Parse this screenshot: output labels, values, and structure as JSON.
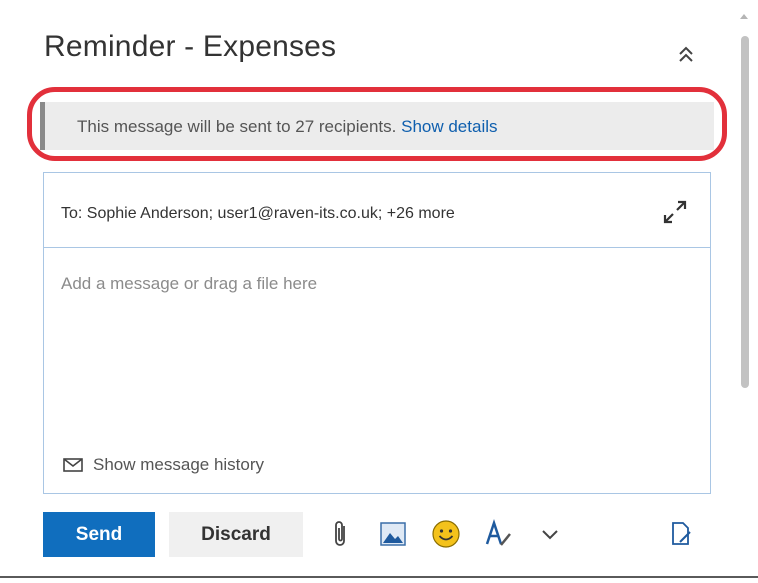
{
  "compose": {
    "subject_title": "Reminder - Expenses",
    "notice": {
      "text": "This message will be sent to 27 recipients.",
      "link": "Show details"
    },
    "to_line": "To:  Sophie Anderson;  user1@raven-its.co.uk;  +26 more",
    "body_placeholder": "Add a message or drag a file here",
    "history_label": "Show message history"
  },
  "toolbar": {
    "send_label": "Send",
    "discard_label": "Discard",
    "tools": [
      "attach-icon",
      "image-icon",
      "emoji-icon",
      "format-text-icon",
      "more-options-chevron-icon",
      "open-in-new-window-icon"
    ]
  },
  "colors": {
    "accent": "#106ebe",
    "link": "#0f5fae",
    "highlight": "#e2303b",
    "emoji": "#f4c21b"
  }
}
